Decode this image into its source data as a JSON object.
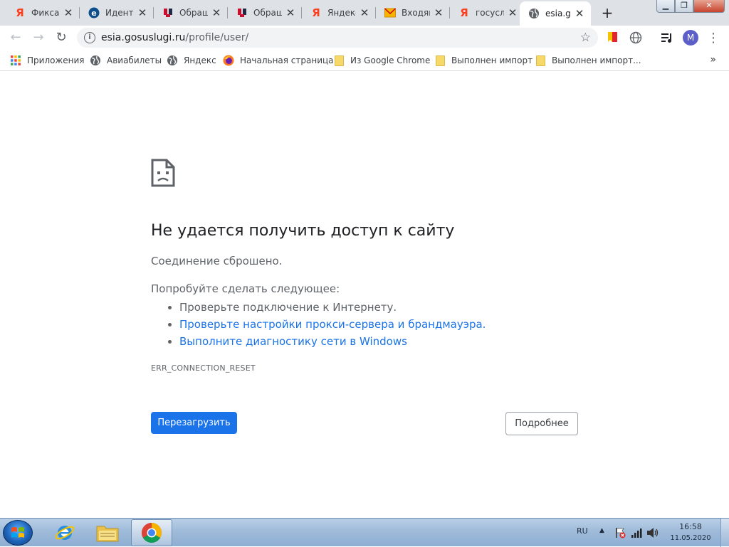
{
  "tabs": [
    {
      "title": "Фиксац",
      "icon": "yandex-icon"
    },
    {
      "title": "Идентı",
      "icon": "esia-e-icon"
    },
    {
      "title": "Обращ",
      "icon": "gerb-icon"
    },
    {
      "title": "Обращ",
      "icon": "gerb-icon"
    },
    {
      "title": "Яндекс",
      "icon": "yandex-icon"
    },
    {
      "title": "Входящ",
      "icon": "mail-envelope-icon"
    },
    {
      "title": "госуслу",
      "icon": "yandex-icon"
    },
    {
      "title": "esia.go",
      "icon": "globe-icon",
      "active": true
    }
  ],
  "tab_close_glyph": "✕",
  "new_tab_glyph": "+",
  "window": {
    "min_glyph": "▁",
    "max_glyph": "❐",
    "close_glyph": "✕"
  },
  "toolbar": {
    "back_glyph": "←",
    "forward_glyph": "→",
    "reload_glyph": "↻",
    "info_glyph": "i",
    "url_host": "esia.gosuslugi.ru",
    "url_path": "/profile/user/",
    "star_glyph": "☆",
    "avatar_letter": "M",
    "menu_glyph": "⋮"
  },
  "bookmarks": [
    {
      "label": "Приложения",
      "icon": "apps-grid-icon"
    },
    {
      "label": "Авиабилеты",
      "icon": "globe-icon"
    },
    {
      "label": "Яндекс",
      "icon": "globe-icon"
    },
    {
      "label": "Начальная страница",
      "icon": "firefox-icon"
    },
    {
      "label": "Из Google Chrome",
      "icon": "folder-icon"
    },
    {
      "label": "Выполнен импорт",
      "icon": "folder-icon"
    },
    {
      "label": "Выполнен импорт...",
      "icon": "folder-icon"
    }
  ],
  "bookmarks_more_glyph": "»",
  "error": {
    "title": "Не удается получить доступ к сайту",
    "subtitle": "Соединение сброшено.",
    "try_label": "Попробуйте сделать следующее:",
    "suggestions": [
      {
        "text": "Проверьте подключение к Интернету.",
        "link": false
      },
      {
        "text": "Проверьте настройки прокси-сервера и брандмауэра.",
        "link": true
      },
      {
        "text": "Выполните диагностику сети в Windows",
        "link": true
      }
    ],
    "code": "ERR_CONNECTION_RESET",
    "reload_label": "Перезагрузить",
    "details_label": "Подробнее"
  },
  "taskbar": {
    "apps": [
      {
        "name": "internet-explorer",
        "icon": "ie-icon"
      },
      {
        "name": "explorer",
        "icon": "folder-explorer-icon"
      },
      {
        "name": "chrome",
        "icon": "chrome-icon",
        "active": true
      }
    ],
    "language": "RU",
    "tray_arrow_glyph": "▲",
    "time": "16:58",
    "date": "11.05.2020"
  },
  "colors": {
    "accent_blue": "#1a73e8",
    "tabstrip_bg": "#dee1e6",
    "yandex_red": "#fc3f1d",
    "text_grey": "#5f6368"
  }
}
